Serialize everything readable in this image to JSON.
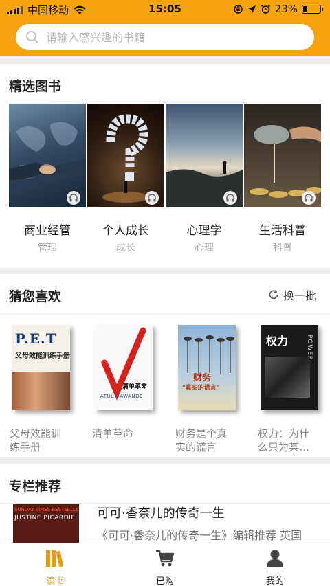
{
  "status_bar": {
    "carrier": "中国移动",
    "time": "15:05",
    "battery": "23%",
    "battery_level": 0.23
  },
  "search": {
    "placeholder": "请输入感兴趣的书籍"
  },
  "featured": {
    "title": "精选图书",
    "items": [
      {
        "name": "商业经管",
        "tag": "管理",
        "icon": "handshake-image"
      },
      {
        "name": "个人成长",
        "tag": "成长",
        "icon": "question-puzzle-image"
      },
      {
        "name": "心理学",
        "tag": "心理",
        "icon": "lone-person-lake-image"
      },
      {
        "name": "生活科普",
        "tag": "科普",
        "icon": "tea-pour-image"
      }
    ]
  },
  "guess": {
    "title": "猜您喜欢",
    "refresh_label": "换一批",
    "books": [
      {
        "title_line1": "父母效能训",
        "title_line2": "练手册",
        "cover_text_big": "P.E.T",
        "cover_text": "父母效能训练手册"
      },
      {
        "title_line1": "清单革命",
        "title_line2": "",
        "cover_text": "清单革命",
        "cover_author": "ATUL GAWANDE"
      },
      {
        "title_line1": "财务是个真",
        "title_line2": "实的谎言",
        "cover_text": "财务",
        "cover_sub": "\"真实的谎言\""
      },
      {
        "title_line1": "权力：为什",
        "title_line2": "么只为某…",
        "cover_text": "权力",
        "cover_side": "POWER"
      }
    ]
  },
  "column": {
    "title": "专栏推荐",
    "item_title": "可可·香奈儿的传奇一生",
    "item_desc": "《可可·香奈儿的传奇一生》编辑推荐 英国",
    "cover_top": "SUNDAY TIMES BESTSELLER",
    "cover_author": "JUSTINE PICARDIE"
  },
  "tabbar": {
    "tabs": [
      {
        "label": "读书",
        "icon": "books-icon",
        "active": true
      },
      {
        "label": "已购",
        "icon": "cart-icon",
        "active": false
      },
      {
        "label": "我的",
        "icon": "user-icon",
        "active": false
      }
    ]
  },
  "colors": {
    "brand": "#f5a30f",
    "active_tab": "#e69a0f"
  }
}
